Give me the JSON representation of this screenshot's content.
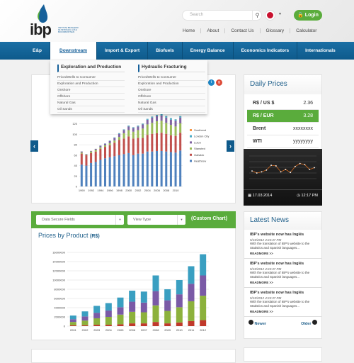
{
  "header": {
    "logo_text": "ibp",
    "logo_sub": "INSTITUTO BRASILEIRO DE PETRÓLEO, GÁS E BIOCOMBUSTÍVEIS",
    "search_placeholder": "Search",
    "login": "Login",
    "top_nav": [
      "Home",
      "About",
      "Contact Us",
      "Glossary",
      "Calculator"
    ]
  },
  "main_nav": [
    "E&p",
    "Downstream",
    "Import & Export",
    "Biofuels",
    "Energy Balance",
    "Economics Indicators",
    "Internationals"
  ],
  "dropdown": {
    "columns": [
      {
        "title": "Exploration and Production",
        "items": [
          "PricedWells to Consumer",
          "Exploration and Production",
          "Onshore",
          "Offshore",
          "Natural Gas",
          "Oil Sands"
        ]
      },
      {
        "title": "Hydraulic Fracturing",
        "items": [
          "PricedWells to Consumer",
          "Exploration and Production",
          "Onshore",
          "Offshore",
          "Natural Gas",
          "Oil Sands"
        ]
      }
    ]
  },
  "daily_prices": {
    "title": "Daily Prices",
    "rows": [
      {
        "label": "R$ / US $",
        "value": "2.36"
      },
      {
        "label": "R$ / EUR",
        "value": "3.28"
      },
      {
        "label": "Brent",
        "value": "xxxxxxxx"
      },
      {
        "label": "WTI",
        "value": "yyyyyyyy"
      }
    ],
    "date": "17.03.2014",
    "time": "12:17 PM",
    "mini_values": [
      450,
      380,
      420,
      480,
      640,
      620,
      420,
      500,
      400,
      600,
      700,
      660,
      500,
      560
    ]
  },
  "custom_chart": {
    "select1": "Data Secure Fields",
    "select2": "View Type",
    "label": "(Custom Chart)",
    "title": "Prices by Product",
    "title_unit": "(R$)"
  },
  "news": {
    "title": "Latest News",
    "items": [
      {
        "title": "IBP's website now has Inglés",
        "date": "5/15/2012 4:24:37 PM",
        "text": "With the translation of IBP's website to the Statistics and Spanish languages...",
        "more": "READMORE >>"
      },
      {
        "title": "IBP's website now has Inglés",
        "date": "5/15/2012 4:24:37 PM",
        "text": "With the translation of IBP's website to the Statistics and Spanish languages...",
        "more": "READMORE >>"
      },
      {
        "title": "IBP's website now has Inglés",
        "date": "5/15/2012 4:24:37 PM",
        "text": "With the translation of IBP's website to the Statistics and Spanish languages...",
        "more": "READMORE >>"
      }
    ],
    "newer": "Newer",
    "older": "Older"
  },
  "chart_data": [
    {
      "type": "bar",
      "stacked": true,
      "ylim": [
        0,
        140
      ],
      "yticks": [
        0,
        20,
        40,
        60,
        80,
        100,
        120
      ],
      "legend": "right",
      "x": [
        "1990",
        "1991",
        "1992",
        "1993",
        "1994",
        "1995",
        "1996",
        "1997",
        "1998",
        "1999",
        "2000",
        "2001",
        "2002",
        "2003",
        "2004",
        "2005",
        "2006",
        "2007",
        "2008",
        "2009",
        "2010",
        "2011"
      ],
      "xticklabels": [
        "1990",
        "1992",
        "1994",
        "1996",
        "1998",
        "2000",
        "2002",
        "2004",
        "2006",
        "2008",
        "2010"
      ],
      "series": [
        {
          "name": "Heathrow",
          "color": "#4f81bd",
          "values": [
            42,
            40,
            45,
            47,
            51,
            54,
            56,
            58,
            60,
            62,
            64,
            60,
            63,
            63,
            67,
            67,
            68,
            68,
            67,
            66,
            65,
            69
          ]
        },
        {
          "name": "Gatwick",
          "color": "#c0504d",
          "values": [
            21,
            20,
            19,
            20,
            21,
            22,
            23,
            26,
            29,
            30,
            32,
            32,
            30,
            30,
            32,
            34,
            34,
            35,
            34,
            32,
            32,
            34
          ]
        },
        {
          "name": "Stansted",
          "color": "#9bbb59",
          "values": [
            2,
            1,
            3,
            3,
            3,
            3,
            4,
            4,
            6,
            10,
            12,
            13,
            15,
            18,
            20,
            21,
            23,
            23,
            21,
            20,
            18,
            18
          ]
        },
        {
          "name": "Luton",
          "color": "#8064a2",
          "values": [
            2,
            1,
            1,
            2,
            3,
            3,
            4,
            5,
            6,
            6,
            7,
            7,
            7,
            8,
            9,
            10,
            10,
            10,
            10,
            10,
            11,
            11
          ]
        },
        {
          "name": "London City",
          "color": "#4bacc6",
          "values": [
            0.2,
            0.2,
            0.2,
            0.2,
            0.5,
            0.5,
            0.8,
            1,
            1.2,
            1.4,
            1.6,
            1.6,
            1.6,
            1.5,
            1.7,
            2,
            2.3,
            2.9,
            3.2,
            3,
            2.8,
            3
          ]
        },
        {
          "name": "Southend",
          "color": "#f79646",
          "values": [
            0.1,
            0.1,
            0.1,
            0.1,
            0.1,
            0.1,
            0.1,
            0.1,
            0.1,
            0.1,
            0.1,
            0.1,
            0.1,
            0.1,
            0.1,
            0.1,
            0.1,
            0.1,
            0.1,
            0.1,
            0.1,
            0.1
          ]
        }
      ]
    },
    {
      "type": "bar",
      "stacked": true,
      "ylim": [
        0,
        16000000
      ],
      "yticks": [
        0,
        2000000,
        4000000,
        6000000,
        8000000,
        10000000,
        12000000,
        14000000,
        16000000
      ],
      "x": [
        "2001",
        "2002",
        "2003",
        "2004",
        "2005",
        "2006",
        "2007",
        "2008",
        "2009",
        "2010",
        "2011",
        "2012"
      ],
      "series": [
        {
          "color": "#c0392b",
          "values": [
            200000,
            200000,
            300000,
            300000,
            400000,
            600000,
            600000,
            900000,
            600000,
            800000,
            1100000,
            1300000
          ]
        },
        {
          "color": "#8cb13c",
          "values": [
            700000,
            1000000,
            1400000,
            1700000,
            2100000,
            2500000,
            2400000,
            3600000,
            2700000,
            3300000,
            4300000,
            5300000
          ]
        },
        {
          "color": "#7a5aa6",
          "values": [
            600000,
            900000,
            1200000,
            1400000,
            1600000,
            2200000,
            2100000,
            3100000,
            2300000,
            2800000,
            3800000,
            4400000
          ]
        },
        {
          "color": "#3a9fc1",
          "values": [
            800000,
            1100000,
            1500000,
            1600000,
            2100000,
            2400000,
            2400000,
            3400000,
            2400000,
            3100000,
            3800000,
            4600000
          ]
        }
      ]
    }
  ]
}
